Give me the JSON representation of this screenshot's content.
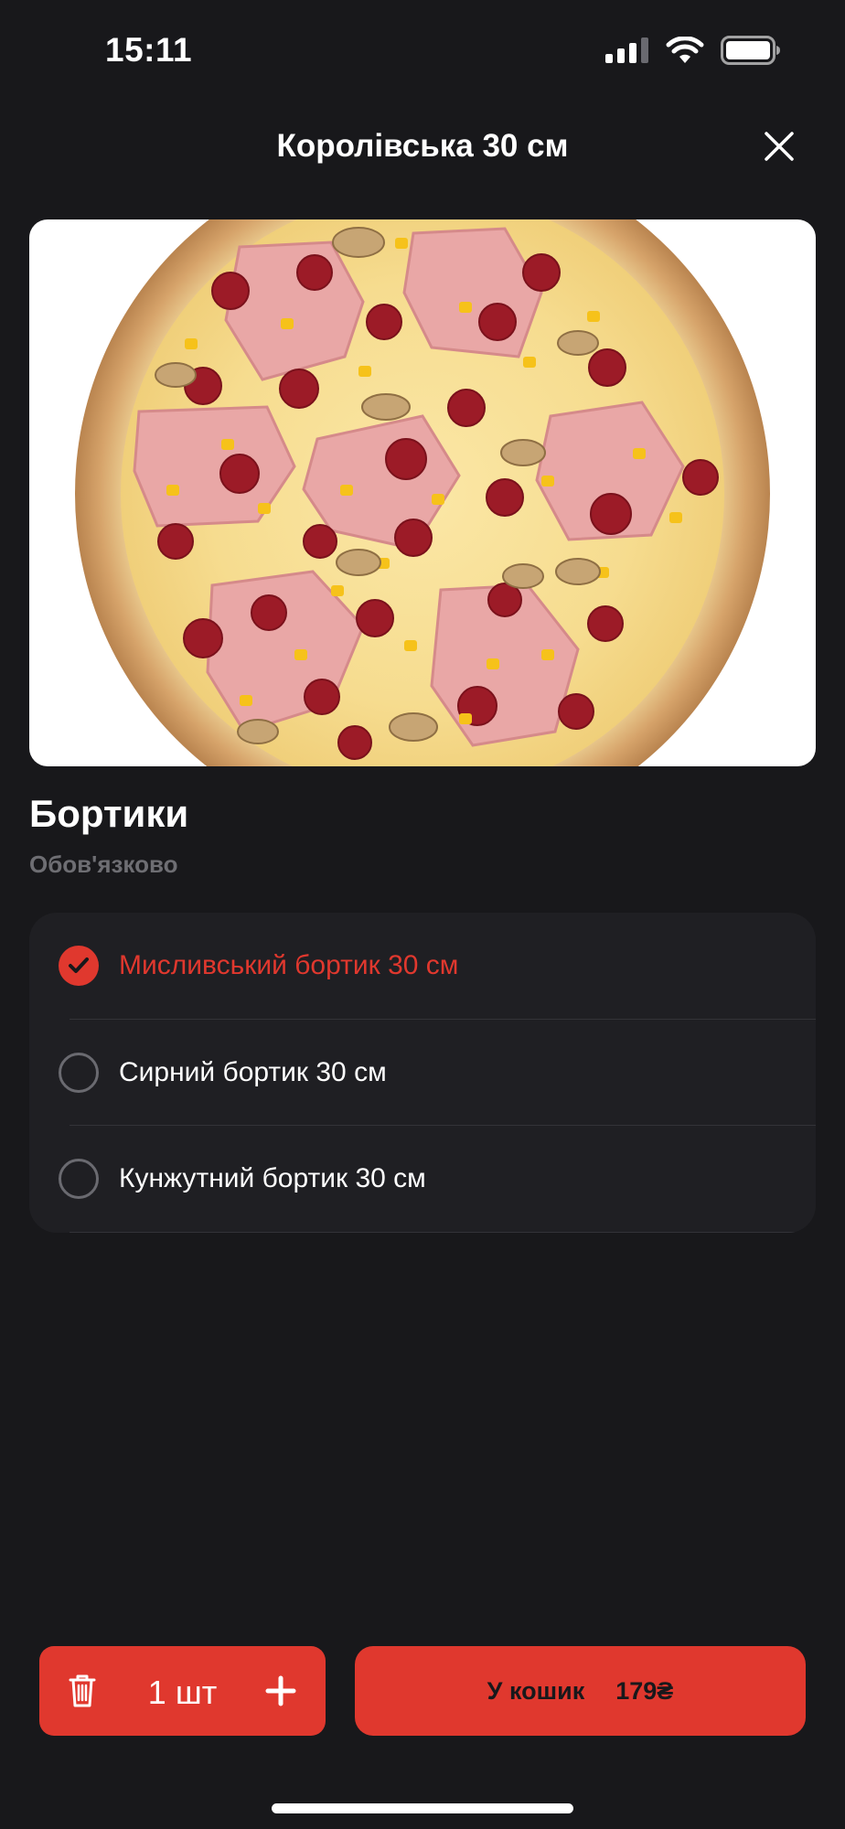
{
  "status_bar": {
    "time": "15:11"
  },
  "header": {
    "title": "Королівська 30 см"
  },
  "product": {
    "image_icon": "pizza-photo"
  },
  "section": {
    "title": "Бортики",
    "subtitle": "Обов'язково",
    "options": [
      {
        "label": "Мисливський бортик 30 см",
        "selected": true
      },
      {
        "label": "Сирний бортик 30 см",
        "selected": false
      },
      {
        "label": "Кунжутний бортик 30 см",
        "selected": false
      }
    ]
  },
  "footer": {
    "quantity": "1 шт",
    "cart_label": "У кошик",
    "price": "179₴"
  },
  "colors": {
    "accent": "#e0382e",
    "background": "#18181b",
    "card": "#1f1f23"
  }
}
